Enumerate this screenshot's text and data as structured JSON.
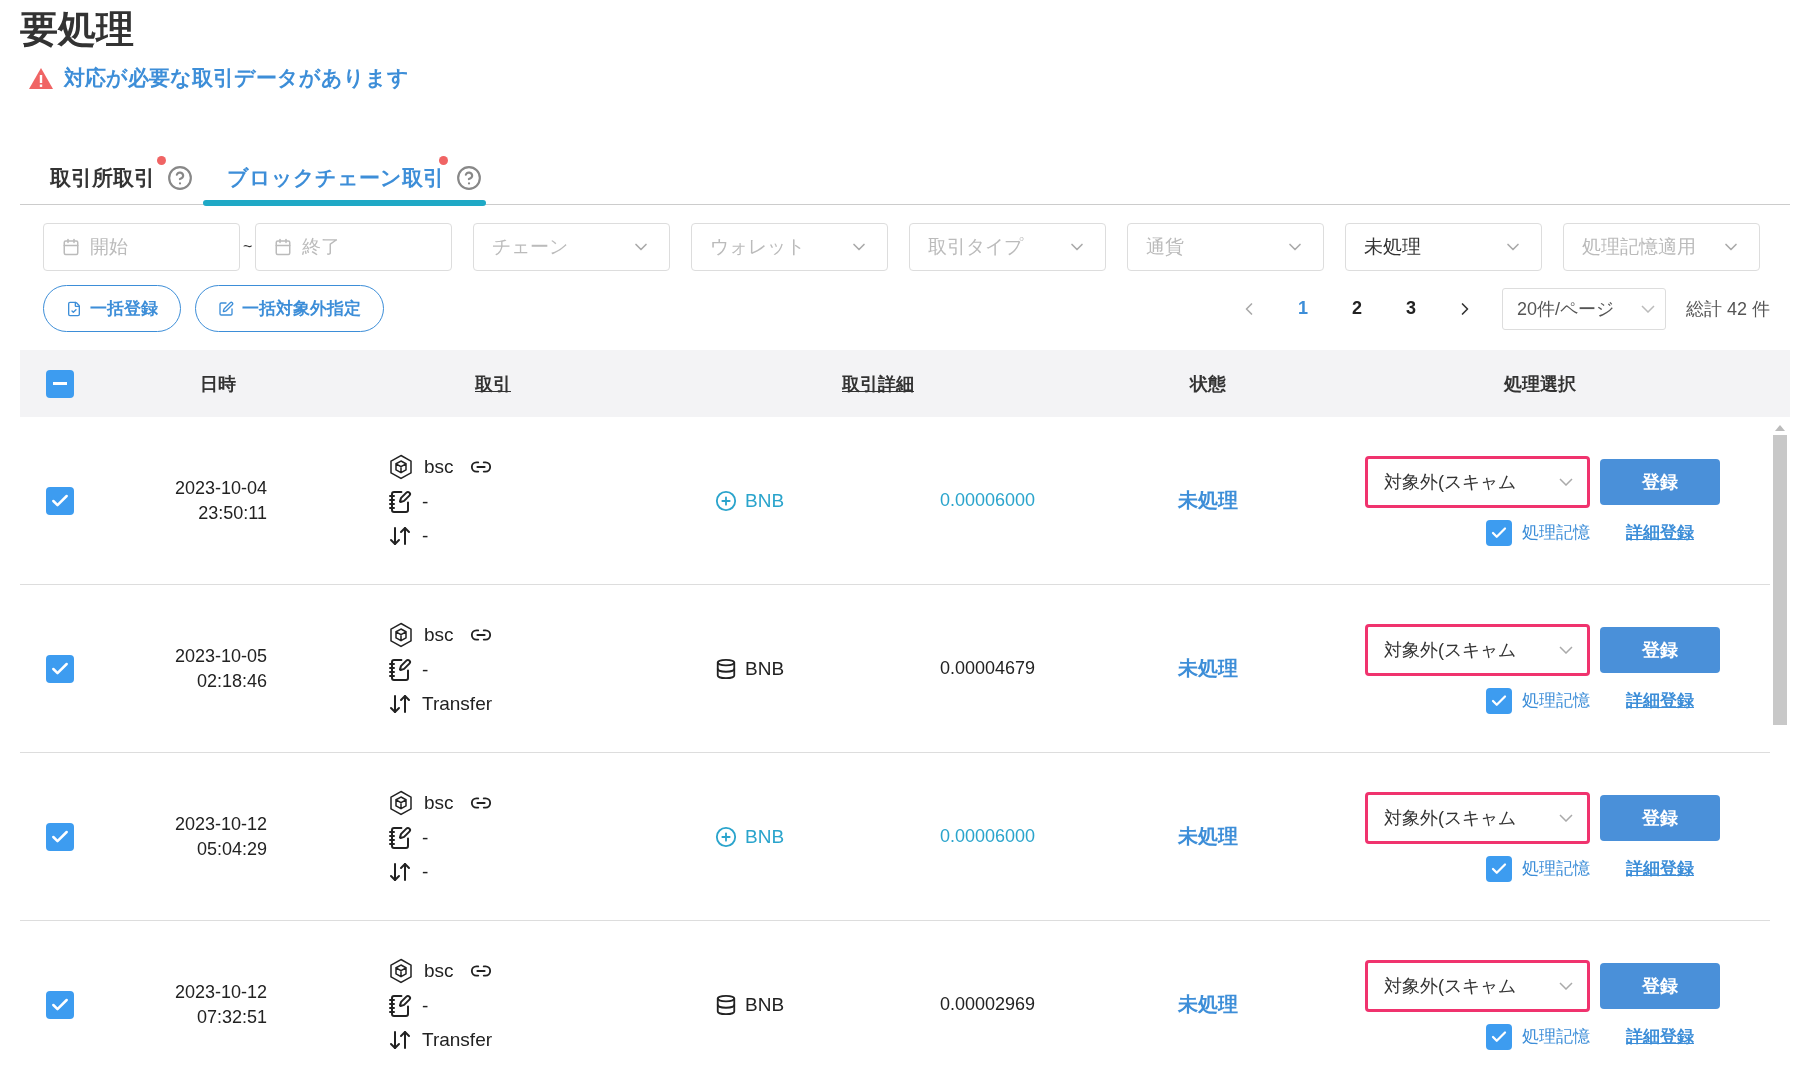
{
  "page_title": "要処理",
  "alert": {
    "text": "対応が必要な取引データがあります"
  },
  "tabs": [
    {
      "label": "取引所取引",
      "selected": false,
      "dot": true
    },
    {
      "label": "ブロックチェーン取引",
      "selected": true,
      "dot": true
    }
  ],
  "filters": [
    {
      "kind": "date",
      "placeholder": "開始"
    },
    {
      "kind": "date",
      "placeholder": "終了"
    },
    {
      "kind": "select",
      "placeholder": "チェーン"
    },
    {
      "kind": "select",
      "placeholder": "ウォレット"
    },
    {
      "kind": "select",
      "placeholder": "取引タイプ"
    },
    {
      "kind": "select",
      "placeholder": "通貨"
    },
    {
      "kind": "select",
      "value": "未処理"
    },
    {
      "kind": "select",
      "placeholder": "処理記憶適用"
    }
  ],
  "date_separator": "~",
  "bulk_buttons": [
    {
      "kind": "register",
      "label": "一括登録"
    },
    {
      "kind": "exclude",
      "label": "一括対象外指定"
    }
  ],
  "pagination": {
    "pages": [
      {
        "label": "1",
        "selected": true
      },
      {
        "label": "2",
        "selected": false
      },
      {
        "label": "3",
        "selected": false
      }
    ],
    "page_size": "20件/ページ",
    "total": "総計 42 件"
  },
  "table": {
    "select_all": {
      "indeterminate": true
    },
    "columns": [
      {
        "label": "日時",
        "sortable": false
      },
      {
        "label": "取引",
        "sortable": true
      },
      {
        "label": "取引詳細",
        "sortable": true
      },
      {
        "label": "状態",
        "sortable": false
      },
      {
        "label": "処理選択",
        "sortable": false
      }
    ],
    "rows": [
      {
        "checked": true,
        "date": "2023-10-04",
        "time": "23:50:11",
        "chain": "bsc",
        "memo": "-",
        "type": "-",
        "kind": "mint",
        "asset": "BNB",
        "amount": "0.00006000",
        "status": "未処理",
        "action": "対象外(スキャム",
        "remember": {
          "checked": true,
          "label": "処理記憶"
        },
        "register": "登録",
        "detail": "詳細登録"
      },
      {
        "checked": true,
        "date": "2023-10-05",
        "time": "02:18:46",
        "chain": "bsc",
        "memo": "-",
        "type": "Transfer",
        "kind": "token",
        "asset": "BNB",
        "amount": "0.00004679",
        "status": "未処理",
        "action": "対象外(スキャム",
        "remember": {
          "checked": true,
          "label": "処理記憶"
        },
        "register": "登録",
        "detail": "詳細登録"
      },
      {
        "checked": true,
        "date": "2023-10-12",
        "time": "05:04:29",
        "chain": "bsc",
        "memo": "-",
        "type": "-",
        "kind": "mint",
        "asset": "BNB",
        "amount": "0.00006000",
        "status": "未処理",
        "action": "対象外(スキャム",
        "remember": {
          "checked": true,
          "label": "処理記憶"
        },
        "register": "登録",
        "detail": "詳細登録"
      },
      {
        "checked": true,
        "date": "2023-10-12",
        "time": "07:32:51",
        "chain": "bsc",
        "memo": "-",
        "type": "Transfer",
        "kind": "token",
        "asset": "BNB",
        "amount": "0.00002969",
        "status": "未処理",
        "action": "対象外(スキャム",
        "remember": {
          "checked": true,
          "label": "処理記憶"
        },
        "register": "登録",
        "detail": "詳細登録"
      }
    ]
  }
}
